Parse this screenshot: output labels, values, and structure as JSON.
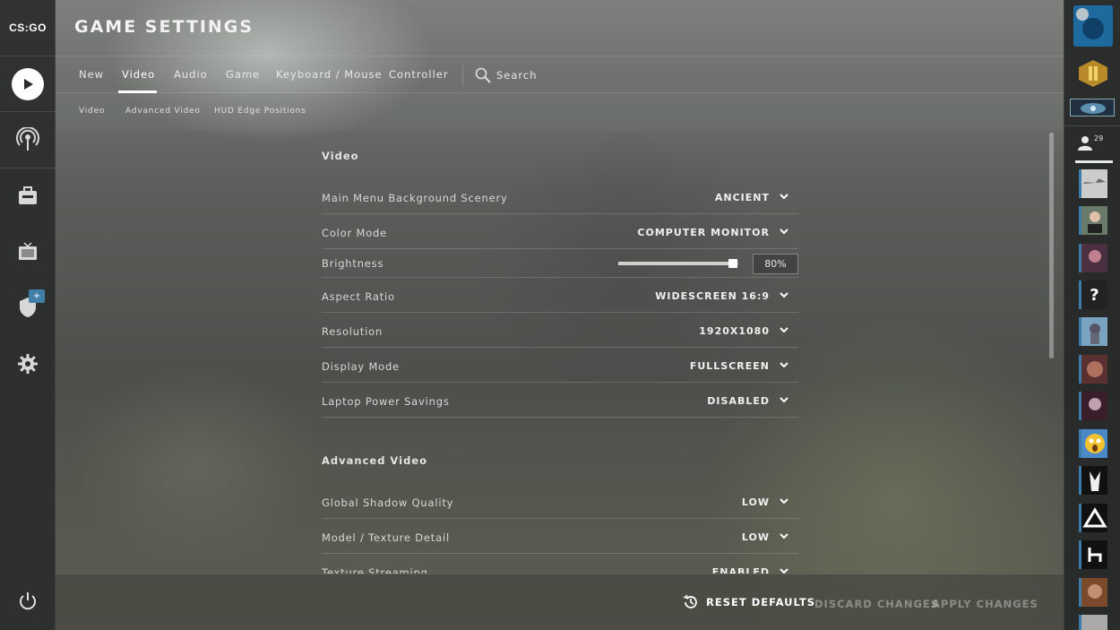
{
  "app": {
    "logo_text": "CS:GO",
    "title": "GAME SETTINGS"
  },
  "tabs": [
    {
      "label": "New"
    },
    {
      "label": "Video"
    },
    {
      "label": "Audio"
    },
    {
      "label": "Game"
    },
    {
      "label": "Keyboard / Mouse"
    },
    {
      "label": "Controller"
    }
  ],
  "active_tab": "Video",
  "search": {
    "label": "Search"
  },
  "subtabs": [
    {
      "label": "Video"
    },
    {
      "label": "Advanced Video"
    },
    {
      "label": "HUD Edge Positions"
    }
  ],
  "video": {
    "section_title": "Video",
    "rows": [
      {
        "label": "Main Menu Background Scenery",
        "value": "ANCIENT"
      },
      {
        "label": "Color Mode",
        "value": "COMPUTER MONITOR"
      },
      {
        "label": "Brightness",
        "value": "80%",
        "slider_fraction": 0.98
      },
      {
        "label": "Aspect Ratio",
        "value": "WIDESCREEN 16:9"
      },
      {
        "label": "Resolution",
        "value": "1920X1080"
      },
      {
        "label": "Display Mode",
        "value": "FULLSCREEN"
      },
      {
        "label": "Laptop Power Savings",
        "value": "DISABLED"
      }
    ]
  },
  "advanced_video": {
    "section_title": "Advanced Video",
    "rows": [
      {
        "label": "Global Shadow Quality",
        "value": "LOW"
      },
      {
        "label": "Model / Texture Detail",
        "value": "LOW"
      },
      {
        "label": "Texture Streaming",
        "value": "ENABLED"
      }
    ]
  },
  "footer": {
    "reset_label": "RESET DEFAULTS",
    "discard_label": "DISCARD CHANGES",
    "apply_label": "APPLY CHANGES"
  },
  "sidebar": {
    "plus_badge": "+"
  },
  "friends": {
    "count": "29",
    "avatar_glyphs": [
      "?"
    ]
  },
  "colors": {
    "accent_blue": "#3c7ba7",
    "panel_dark": "#2a2c2c"
  }
}
